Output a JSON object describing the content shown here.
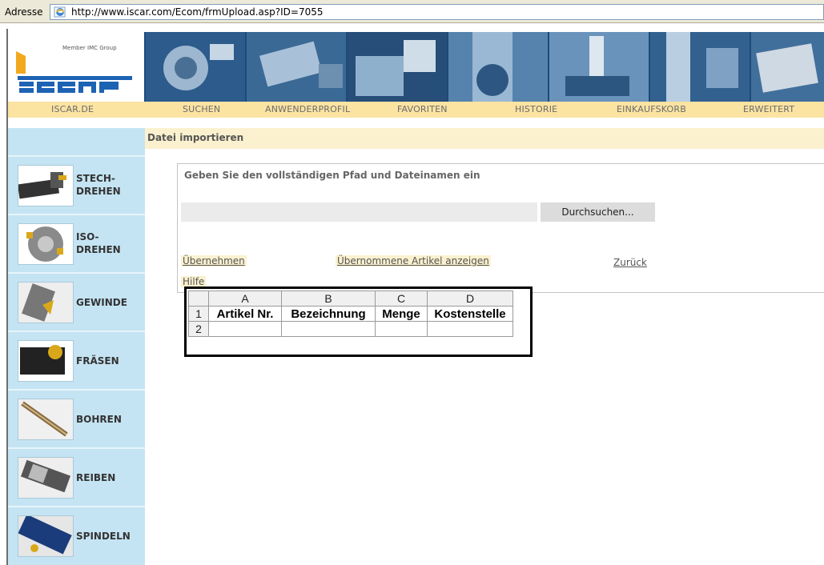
{
  "address_bar": {
    "label": "Adresse",
    "url": "http://www.iscar.com/Ecom/frmUpload.asp?ID=7055"
  },
  "banner": {
    "tagline": "Member IMC Group",
    "logo_text": "ISCAR"
  },
  "nav": [
    {
      "label": "ISCAR.DE"
    },
    {
      "label": "SUCHEN"
    },
    {
      "label": "ANWENDERPROFIL"
    },
    {
      "label": "FAVORITEN"
    },
    {
      "label": "HISTORIE"
    },
    {
      "label": "EINKAUFSKORB"
    },
    {
      "label": "ERWEITERT"
    }
  ],
  "sidebar": {
    "items": [
      {
        "label": "STECH-\nDREHEN",
        "icon": "grooving-tool-icon"
      },
      {
        "label": "ISO-\nDREHEN",
        "icon": "turning-tool-icon"
      },
      {
        "label": "GEWINDE",
        "icon": "threading-tool-icon"
      },
      {
        "label": "FRÄSEN",
        "icon": "milling-tool-icon"
      },
      {
        "label": "BOHREN",
        "icon": "drilling-tool-icon"
      },
      {
        "label": "REIBEN",
        "icon": "reaming-tool-icon"
      },
      {
        "label": "SPINDELN",
        "icon": "spindle-tool-icon"
      }
    ]
  },
  "header": {
    "title": "Datei importieren"
  },
  "upload": {
    "instruction": "Geben Sie den vollständigen Pfad und Dateinamen ein",
    "file_value": "",
    "browse_label": "Durchsuchen...",
    "links": {
      "apply": "Übernehmen",
      "show_imported": "Übernommene Artikel anzeigen",
      "back": "Zurück",
      "help": "Hilfe"
    }
  },
  "excel": {
    "columns": [
      "A",
      "B",
      "C",
      "D"
    ],
    "rows": [
      {
        "num": "1",
        "cells": [
          "Artikel Nr.",
          "Bezeichnung",
          "Menge",
          "Kostenstelle"
        ]
      },
      {
        "num": "2",
        "cells": [
          "",
          "",
          "",
          ""
        ]
      }
    ]
  },
  "colors": {
    "nav_bg": "#fbe3a2",
    "sidebar_bg": "#c5e4f3",
    "header_bg": "#fbf1cf",
    "banner_blue": "#1d4a7a"
  }
}
